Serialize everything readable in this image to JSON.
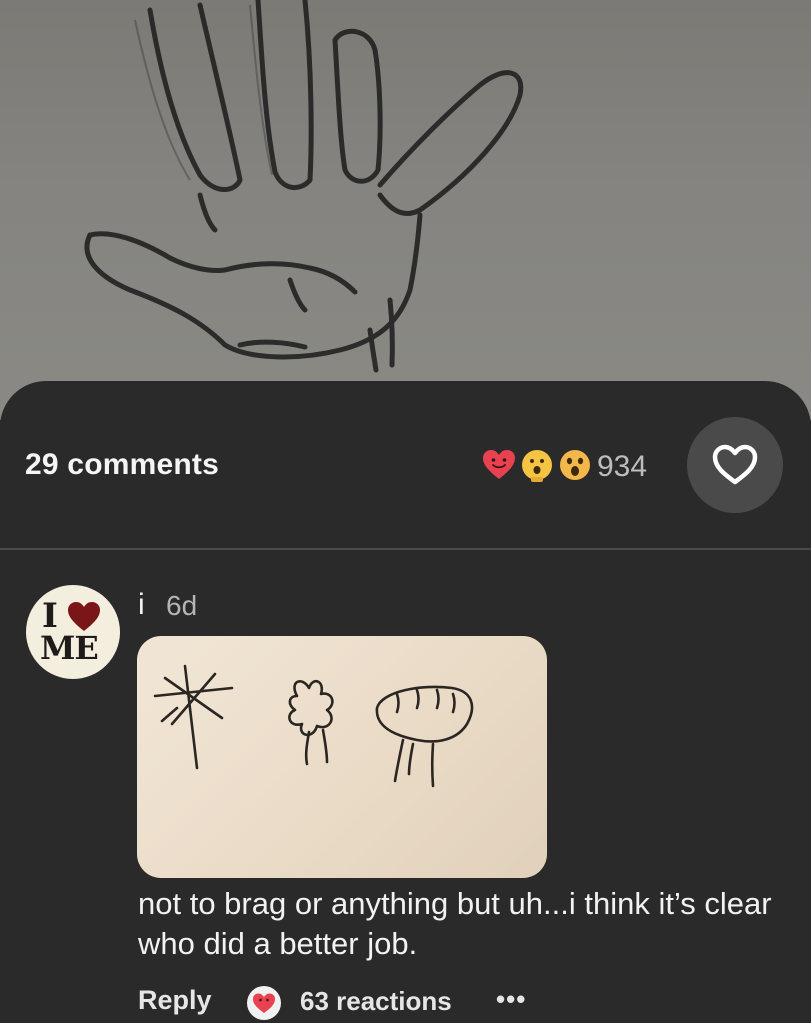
{
  "post": {
    "comments_label": "29 comments",
    "reactions_total": "934",
    "reaction_icons": [
      "heart-face-icon",
      "smiling-face-icon",
      "shocked-face-icon"
    ]
  },
  "comment": {
    "author": "i",
    "time": "6d",
    "avatar_text_top": "I",
    "avatar_text_bottom": "ME",
    "text": "not to brag or anything but uh...i think it’s clear who did a better job.",
    "reply_label": "Reply",
    "reactions_label": "63 reactions",
    "more_label": "•••"
  },
  "colors": {
    "background": "#2a2a2b",
    "like_button": "#4a4a4b",
    "heart_red": "#e84250",
    "emoji_yellow": "#f5c443"
  }
}
